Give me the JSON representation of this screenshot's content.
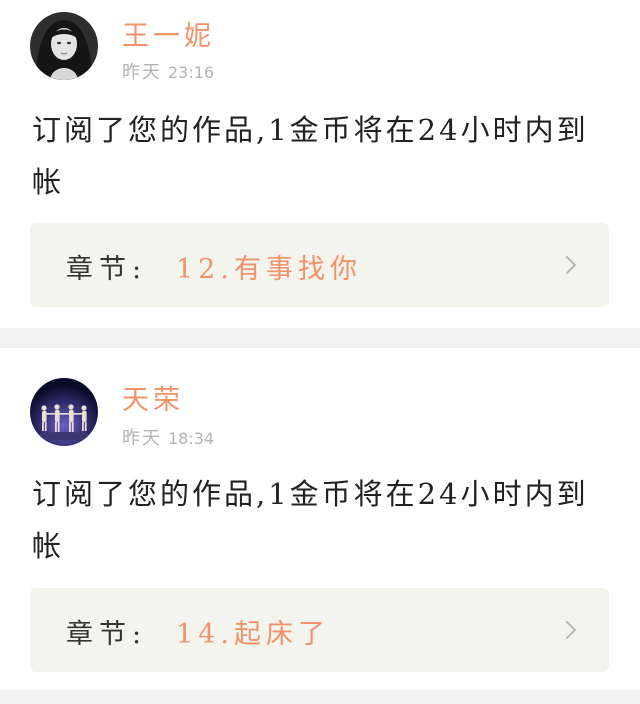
{
  "notifications": [
    {
      "username": "王一妮",
      "date": "昨天",
      "time": "23:16",
      "message": "订阅了您的作品,1金币将在24小时内到帐",
      "chapter_label": "章节:",
      "chapter_title": "12.有事找你"
    },
    {
      "username": "天荣",
      "date": "昨天",
      "time": "18:34",
      "message": "订阅了您的作品,1金币将在24小时内到帐",
      "chapter_label": "章节:",
      "chapter_title": "14.起床了"
    }
  ],
  "colors": {
    "accent": "#f0926a",
    "page_bg": "#f2f2f2",
    "chapter_bg": "#f4f4ef"
  }
}
